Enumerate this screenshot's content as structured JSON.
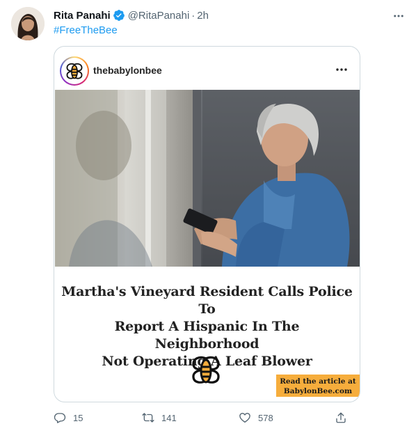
{
  "tweet": {
    "author_name": "Rita Panahi",
    "handle": "@RitaPanahi",
    "separator": "·",
    "time": "2h",
    "hashtag": "#FreeTheBee",
    "verified_color": "#1d9bf0",
    "link_color": "#1d9bf0"
  },
  "embed": {
    "username": "thebabylonbee",
    "headline_lines": [
      "Martha's Vineyard Resident Calls Police To",
      "Report A Hispanic In The Neighborhood",
      "Not Operating A Leaf Blower"
    ],
    "cta_lines": [
      "Read the article at",
      "BabylonBee.com"
    ],
    "cta_color": "#f6ad3c"
  },
  "actions": {
    "reply_count": "15",
    "retweet_count": "141",
    "like_count": "578"
  },
  "icons": {
    "more": "more-horizontal-icon",
    "verified": "verified-badge-icon",
    "reply": "reply-icon",
    "retweet": "retweet-icon",
    "like": "heart-icon",
    "share": "share-icon"
  }
}
